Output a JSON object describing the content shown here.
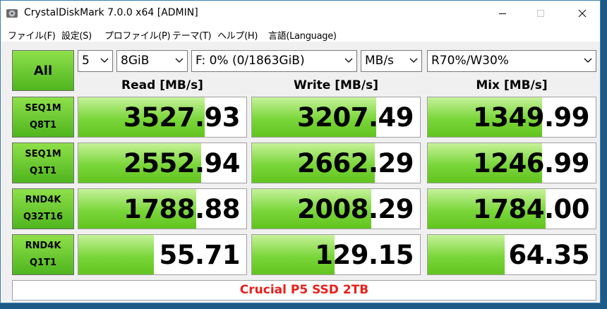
{
  "window": {
    "title": "CrystalDiskMark 7.0.0 x64 [ADMIN]",
    "accent_color": "#3c7fb1"
  },
  "menu": {
    "items": [
      "ファイル(F)",
      "設定(S)",
      "プロファイル(P)",
      "テーマ(T)",
      "ヘルプ(H)",
      "言語(Language)"
    ]
  },
  "controls": {
    "all_button": "All",
    "count": "5",
    "size": "8GiB",
    "drive": "F: 0% (0/1863GiB)",
    "unit": "MB/s",
    "mix": "R70%/W30%"
  },
  "columns": [
    "Read [MB/s]",
    "Write [MB/s]",
    "Mix [MB/s]"
  ],
  "tests": [
    {
      "line1": "SEQ1M",
      "line2": "Q8T1",
      "read": "3527.93",
      "write": "3207.49",
      "mix": "1349.99",
      "read_fill": 0.75,
      "write_fill": 0.74,
      "mix_fill": 0.68
    },
    {
      "line1": "SEQ1M",
      "line2": "Q1T1",
      "read": "2552.94",
      "write": "2662.29",
      "mix": "1246.99",
      "read_fill": 0.73,
      "write_fill": 0.73,
      "mix_fill": 0.68
    },
    {
      "line1": "RND4K",
      "line2": "Q32T16",
      "read": "1788.88",
      "write": "2008.29",
      "mix": "1784.00",
      "read_fill": 0.7,
      "write_fill": 0.71,
      "mix_fill": 0.7
    },
    {
      "line1": "RND4K",
      "line2": "Q1T1",
      "read": "55.71",
      "write": "129.15",
      "mix": "64.35",
      "read_fill": 0.45,
      "write_fill": 0.49,
      "mix_fill": 0.46
    }
  ],
  "comment": "Crucial P5 SSD 2TB",
  "colors": {
    "bar_green": "#7ad63a",
    "button_green": "#6cc832",
    "comment_red": "#e8201c"
  }
}
